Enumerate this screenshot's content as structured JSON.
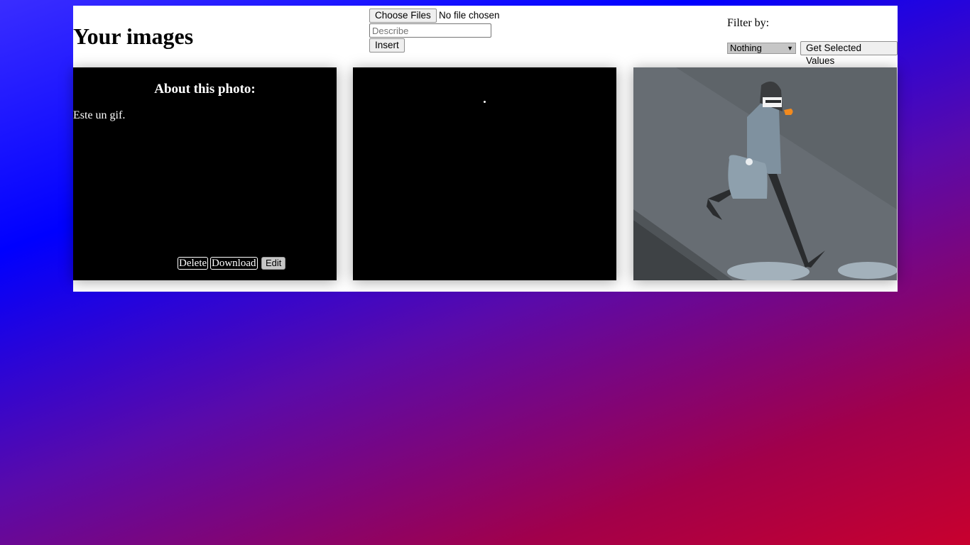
{
  "header": {
    "title": "Your images",
    "file_button_label": "Choose Files",
    "file_status": "No file chosen",
    "describe_placeholder": "Describe",
    "insert_label": "Insert",
    "filter_label": "Filter by:",
    "filter_selected": "Nothing",
    "get_values_label": "Get Selected Values"
  },
  "cards": [
    {
      "about_title": "About this photo:",
      "description": "Este un gif.",
      "actions": {
        "delete": "Delete",
        "download": "Download",
        "edit": "Edit"
      }
    },
    {
      "image": "black-image"
    },
    {
      "image": "walking-man-illustration"
    }
  ],
  "colors": {
    "background_gradient": [
      "#3a2dff",
      "#0000ff",
      "#5a0aaa",
      "#c8002e"
    ],
    "panel": "#ffffff",
    "card_overlay": "#000000"
  }
}
